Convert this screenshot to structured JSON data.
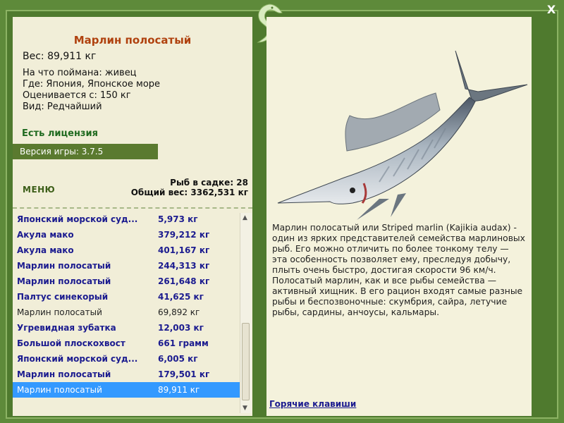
{
  "window": {
    "close_label": "X"
  },
  "fish": {
    "title": "Марлин полосатый",
    "weight": "Вес: 89,911 кг",
    "bait": "На что поймана: живец",
    "location": "Где: Япония, Японское море",
    "valued_from": "Оценивается с: 150 кг",
    "rarity": "Вид: Редчайший"
  },
  "license": "Есть лицензия",
  "version": "Версия игры: 3.7.5",
  "menu_label": "МЕНЮ",
  "stats": {
    "fish_in_keepnet": "Рыб в садке: 28",
    "total_weight": "Общий вес: 3362,531 кг"
  },
  "catch_list": [
    {
      "name": "Японский морской суд...",
      "weight": "5,973 кг",
      "style": "rare"
    },
    {
      "name": "Акула мако",
      "weight": "379,212 кг",
      "style": "rare"
    },
    {
      "name": "Акула мако",
      "weight": "401,167 кг",
      "style": "rare"
    },
    {
      "name": "Марлин полосатый",
      "weight": "244,313 кг",
      "style": "rare"
    },
    {
      "name": "Марлин полосатый",
      "weight": "261,648 кг",
      "style": "rare"
    },
    {
      "name": "Палтус синекорый",
      "weight": "41,625 кг",
      "style": "rare"
    },
    {
      "name": "Марлин полосатый",
      "weight": "69,892 кг",
      "style": "common"
    },
    {
      "name": "Угревидная зубатка",
      "weight": "12,003 кг",
      "style": "rare"
    },
    {
      "name": "Большой плоскохвост",
      "weight": "661 грамм",
      "style": "rare"
    },
    {
      "name": "Японский морской суд...",
      "weight": "6,005 кг",
      "style": "rare"
    },
    {
      "name": "Марлин полосатый",
      "weight": "179,501 кг",
      "style": "rare"
    },
    {
      "name": "Марлин полосатый",
      "weight": "89,911 кг",
      "style": "selected"
    }
  ],
  "description": "Марлин полосатый или Striped marlin (Kajikia audax) - один из ярких представителей семейства марлиновых рыб. Его можно отличить по более тонкому телу — эта особенность позволяет ему, преследуя добычу, плыть очень быстро, достигая скорости 96 км/ч. Полосатый марлин, как и все рыбы семейства — активный хищник. В его рацион входят самые разные рыбы и беспозвоночные: скумбрия, сайра, летучие рыбы, сардины, анчоусы, кальмары.",
  "hotkeys_label": "Горячие клавиши",
  "colors": {
    "frame": "#4f7a2e",
    "panel": "#f1eed8",
    "title": "#b0420f",
    "rare_text": "#1b1b8f",
    "selected": "#3399ff",
    "license": "#1f6a1f"
  }
}
